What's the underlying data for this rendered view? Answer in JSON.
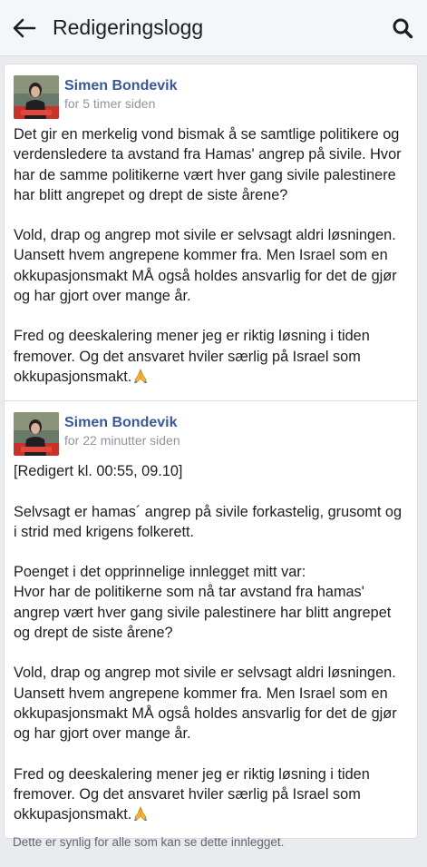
{
  "header": {
    "title": "Redigeringslogg"
  },
  "entries": [
    {
      "author": "Simen Bondevik",
      "time": "for 5 timer siden",
      "paragraphs": [
        "Det gir en merkelig vond bismak å se samtlige politikere og verdensledere ta avstand fra Hamas' angrep på sivile. Hvor har de samme politikerne vært hver gang sivile palestinere har blitt angrepet og drept de siste årene?",
        "Vold, drap og angrep mot sivile er selvsagt aldri løsningen. Uansett hvem angrepene kommer fra. Men Israel som en okkupasjonsmakt MÅ også holdes ansvarlig for det de gjør og har gjort over mange år.",
        "Fred og deeskalering mener jeg er riktig løsning i tiden fremover. Og det ansvaret hviler særlig på Israel som okkupasjonsmakt."
      ]
    },
    {
      "author": "Simen Bondevik",
      "time": "for 22 minutter siden",
      "edited_label": "[Redigert kl. 00:55, 09.10]",
      "paragraphs": [
        "Selvsagt er hamas´ angrep på sivile forkastelig, grusomt og i strid med krigens folkerett.",
        "Poenget i det opprinnelige innlegget mitt var:",
        "Hvor har de politikerne som nå tar avstand fra hamas' angrep vært hver gang sivile palestinere har blitt angrepet og drept de siste årene?",
        "Vold, drap og angrep mot sivile er selvsagt aldri løsningen. Uansett hvem angrepene kommer fra. Men Israel som en okkupasjonsmakt MÅ også holdes ansvarlig for det de gjør og har gjort over mange år.",
        "Fred og deeskalering mener jeg er riktig løsning i tiden fremover. Og det ansvaret hviler særlig på Israel som okkupasjonsmakt."
      ]
    }
  ],
  "footer": {
    "visibility_note": "Dette er synlig for alle som kan se dette innlegget."
  },
  "icons": {
    "back": "arrow-left-icon",
    "search": "search-icon",
    "emoji": "folded-hands-emoji"
  },
  "colors": {
    "name_link": "#385898",
    "meta_gray": "#90949c",
    "background": "#e9ebee"
  }
}
